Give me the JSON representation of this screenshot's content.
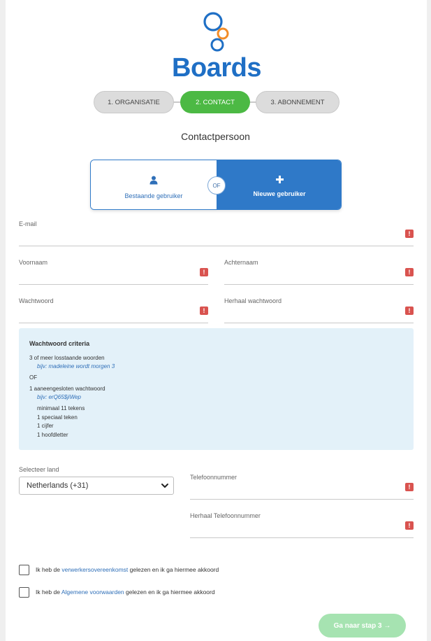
{
  "brand": {
    "name": "Boards",
    "color": "#1f6fc5",
    "accent": "#f28c28"
  },
  "steps": [
    {
      "label": "1. ORGANISATIE",
      "state": "inactive"
    },
    {
      "label": "2. CONTACT",
      "state": "active"
    },
    {
      "label": "3. ABONNEMENT",
      "state": "inactive"
    }
  ],
  "section_title": "Contactpersoon",
  "user_toggle": {
    "existing_label": "Bestaande gebruiker",
    "existing_icon": "user-icon",
    "new_label": "Nieuwe gebruiker",
    "new_icon": "plus-icon",
    "or_label": "OF",
    "selected": "new"
  },
  "fields": {
    "email": {
      "label": "E-mail",
      "value": ""
    },
    "first_name": {
      "label": "Voornaam",
      "value": ""
    },
    "last_name": {
      "label": "Achternaam",
      "value": ""
    },
    "password": {
      "label": "Wachtwoord",
      "value": ""
    },
    "password_repeat": {
      "label": "Herhaal wachtwoord",
      "value": ""
    },
    "phone": {
      "label": "Telefoonnummer",
      "value": ""
    },
    "phone_repeat": {
      "label": "Herhaal Telefoonnummer",
      "value": ""
    },
    "error_mark": "!"
  },
  "criteria": {
    "title": "Wachtwoord criteria",
    "words_rule": "3 of meer losstaande woorden",
    "words_example": "bijv: madeleine wordt morgen 3",
    "or": "OF",
    "single_rule": "1 aaneengesloten wachtwoord",
    "single_example": "bijv: erQ65$jiWep",
    "requirements": [
      "minimaal 11 tekens",
      "1 speciaal teken",
      "1 cijfer",
      "1 hoofdletter"
    ]
  },
  "country": {
    "label": "Selecteer land",
    "value": "Netherlands (+31)"
  },
  "agreements": [
    {
      "prefix": "Ik heb de ",
      "link": "verwerkersovereenkomst",
      "suffix": " gelezen en ik ga hiermee akkoord"
    },
    {
      "prefix": "Ik heb de ",
      "link": "Algemene voorwaarden",
      "suffix": " gelezen en ik ga hiermee akkoord"
    }
  ],
  "next_button": {
    "label": "Ga naar stap 3 →"
  },
  "colors": {
    "active_step": "#4cb944",
    "primary_blue": "#2f79c8",
    "error": "#d9534f",
    "criteria_bg": "#e3f1f9",
    "next_disabled": "#a6e3b1"
  }
}
